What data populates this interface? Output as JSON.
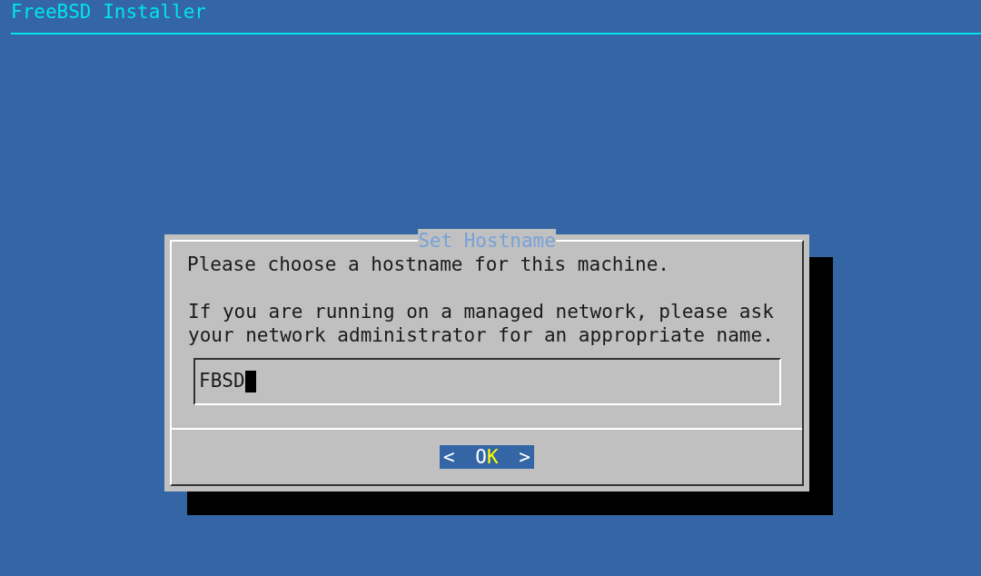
{
  "header": {
    "title": "FreeBSD Installer"
  },
  "dialog": {
    "title": "Set Hostname",
    "message": [
      [
        "Please choose a hostname for this machine."
      ],
      [
        "If you are running on a managed network, please ask",
        "your network administrator for an appropriate name."
      ]
    ],
    "input": {
      "value": "FBSD"
    },
    "buttons": [
      {
        "left": "<",
        "label": "O",
        "hotkey": "K",
        "right": ">",
        "selected": true
      }
    ]
  }
}
